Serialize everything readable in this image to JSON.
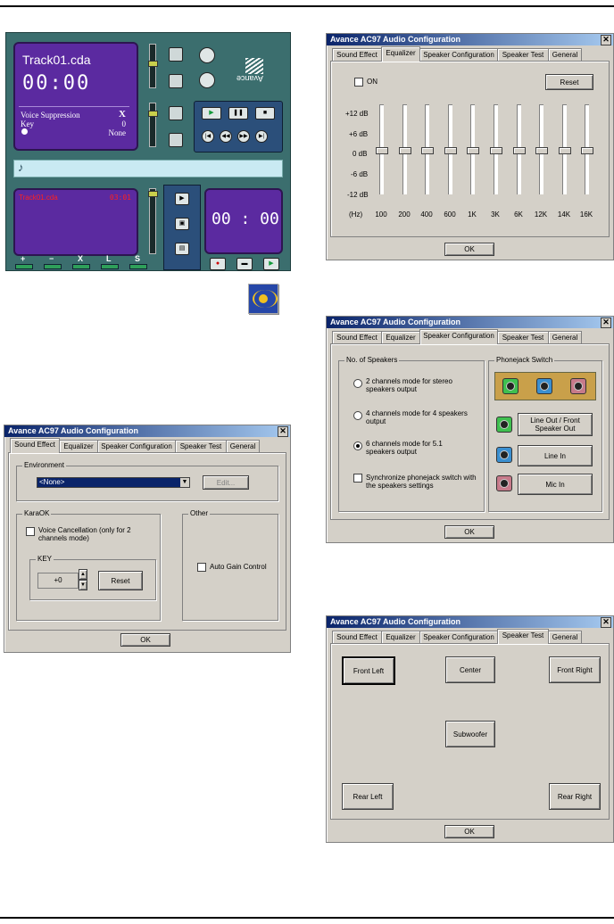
{
  "player": {
    "track_name": "Track01.cda",
    "time": "00:00",
    "voice_suppression": "Voice Suppression",
    "vs_mark": "X",
    "key_label": "Key",
    "key_value": "0",
    "mode_value": "None",
    "lower_track": "Track01.cda",
    "lower_time": "03:01",
    "right_time": "00 : 00",
    "brand": "Avance",
    "bottom_labels": [
      "+",
      "−",
      "X",
      "L",
      "S"
    ]
  },
  "dialog_title": "Avance AC97 Audio Configuration",
  "tabs": [
    "Sound Effect",
    "Equalizer",
    "Speaker Configuration",
    "Speaker Test",
    "General"
  ],
  "ok_label": "OK",
  "sound_effect": {
    "environment_label": "Environment",
    "environment_value": "<None>",
    "edit_label": "Edit...",
    "karaok_label": "KaraOK",
    "voice_cancel_label": "Voice Cancellation (only for 2 channels mode)",
    "key_group_label": "KEY",
    "key_value": "+0",
    "reset_label": "Reset",
    "other_label": "Other",
    "auto_gain_label": "Auto Gain Control"
  },
  "equalizer": {
    "on_label": "ON",
    "reset_label": "Reset",
    "db_labels": [
      "+12 dB",
      "+6 dB",
      "0 dB",
      "-6 dB",
      "-12 dB"
    ],
    "hz_label": "(Hz)",
    "bands": [
      "100",
      "200",
      "400",
      "600",
      "1K",
      "3K",
      "6K",
      "12K",
      "14K",
      "16K"
    ],
    "levels_db": [
      0,
      0,
      0,
      0,
      0,
      0,
      0,
      0,
      0,
      0
    ]
  },
  "speaker_config": {
    "no_of_speakers": "No. of Speakers",
    "options": [
      {
        "label": "2 channels mode for stereo speakers output",
        "selected": false
      },
      {
        "label": "4 channels mode for 4 speakers output",
        "selected": false
      },
      {
        "label": "6 channels mode for 5.1 speakers output",
        "selected": true
      }
    ],
    "sync_label": "Synchronize phonejack switch with the speakers settings",
    "phonejack_label": "Phonejack Switch",
    "jacks": [
      {
        "label": "Line Out / Front Speaker Out",
        "color": "#3fbf4f"
      },
      {
        "label": "Line In",
        "color": "#3b8fd0"
      },
      {
        "label": "Mic In",
        "color": "#c77a8a"
      }
    ]
  },
  "speaker_test": {
    "front_left": "Front Left",
    "center": "Center",
    "front_right": "Front Right",
    "subwoofer": "Subwoofer",
    "rear_left": "Rear Left",
    "rear_right": "Rear Right"
  }
}
